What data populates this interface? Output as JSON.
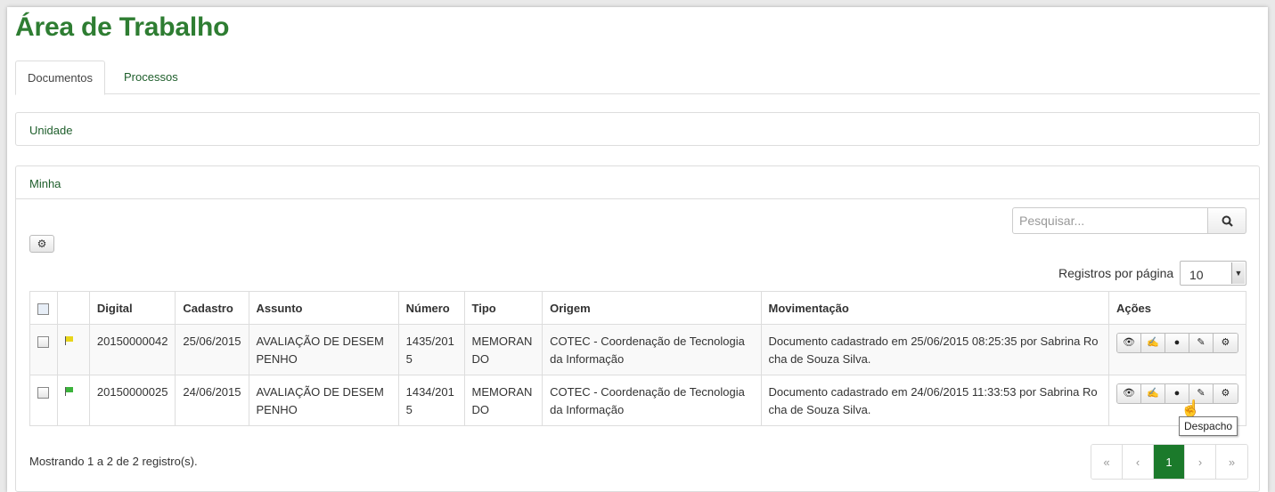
{
  "page": {
    "title": "Área de Trabalho"
  },
  "tabs": [
    {
      "label": "Documentos"
    },
    {
      "label": "Processos"
    }
  ],
  "panels": {
    "unidade": "Unidade",
    "minha": "Minha"
  },
  "search": {
    "placeholder": "Pesquisar..."
  },
  "perpage": {
    "label": "Registros por página",
    "value": "10"
  },
  "table": {
    "columns": [
      "",
      "",
      "Digital",
      "Cadastro",
      "Assunto",
      "Número",
      "Tipo",
      "Origem",
      "Movimentação",
      "Ações"
    ],
    "rows": [
      {
        "flag": "yellow",
        "digital": "20150000042",
        "cadastro": "25/06/2015",
        "assunto": "AVALIAÇÃO DE DESEMPENHO",
        "numero": "1435/2015",
        "tipo": "MEMORANDO",
        "origem": "COTEC - Coordenação de Tecnologia da Informação",
        "movimentacao": "Documento cadastrado em 25/06/2015 08:25:35 por Sabrina Rocha de Souza Silva."
      },
      {
        "flag": "green",
        "digital": "20150000025",
        "cadastro": "24/06/2015",
        "assunto": "AVALIAÇÃO DE DESEMPENHO",
        "numero": "1434/2015",
        "tipo": "MEMORANDO",
        "origem": "COTEC - Coordenação de Tecnologia da Informação",
        "movimentacao": "Documento cadastrado em 24/06/2015 11:33:53 por Sabrina Rocha de Souza Silva."
      }
    ]
  },
  "actions": [
    "eye-icon",
    "sign-icon",
    "despacho-icon",
    "edit-icon",
    "gear-icon"
  ],
  "tooltip": "Despacho",
  "footer": {
    "showing": "Mostrando 1 a 2 de 2 registro(s)."
  },
  "pagination": [
    "«",
    "‹",
    "1",
    "›",
    "»"
  ],
  "colors": {
    "brand": "#2e7d32",
    "link": "#1e5e2b",
    "active_page": "#1b7a2b"
  }
}
